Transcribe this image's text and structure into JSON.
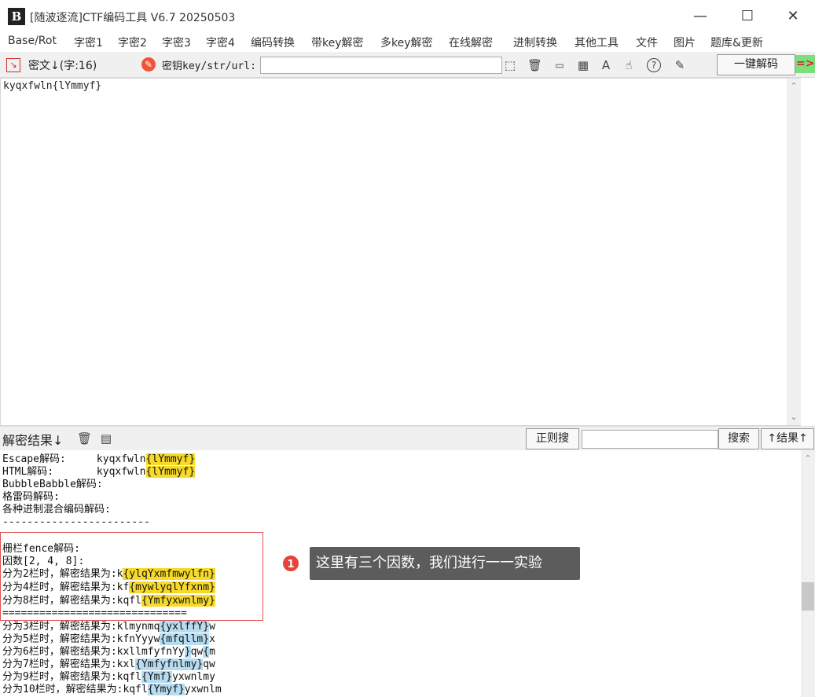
{
  "window": {
    "logo_text": "B",
    "title": "[随波逐流]CTF编码工具 V6.7  20250503",
    "minimize": "—",
    "maximize": "☐",
    "close": "✕"
  },
  "menu": [
    "Base/Rot",
    "字密1",
    "字密2",
    "字密3",
    "字密4",
    "编码转换",
    "带key解密",
    "多key解密",
    "在线解密",
    "进制转换",
    "其他工具",
    "文件",
    "图片",
    "题库&更新"
  ],
  "toolbar": {
    "cipher_label": "密文↓(字:16)",
    "key_label": "密钥key/str/url:",
    "key_value": "",
    "oneclick": "一键解码",
    "arrow": "=>"
  },
  "input": {
    "text": "kyqxfwln{lYmmyf}"
  },
  "result_bar": {
    "label": "解密结果↓",
    "regex_button": "正则搜",
    "regex_value": "",
    "search_button": "搜索",
    "result_button": "↑结果↑"
  },
  "output": {
    "escape_label": "Escape解码:     ",
    "escape_a": "kyqxfwln",
    "escape_b": "{lYmmyf}",
    "html_label": "HTML解码:       ",
    "html_a": "kyqxfwln",
    "html_b": "{lYmmyf}",
    "bubble": "BubbleBabble解码:",
    "grille": "格雷码解码:",
    "mixed": "各种进制混合编码解码:",
    "dash_line": "------------------------",
    "fence_title": "栅栏fence解码:",
    "factors": "因数[2, 4, 8]:",
    "r2_label": "分为2栏时，解密结果为:k",
    "r2_hl": "{ylqYxmfmwylfn}",
    "r4_label": "分为4栏时，解密结果为:kf",
    "r4_hl": "{mywlyqlYfxnm}",
    "r8_label": "分为8栏时，解密结果为:kqfl",
    "r8_hl": "{Ymfyxwnlmy}",
    "eq_line": "==============================",
    "r3_label": "分为3栏时，解密结果为:klmynmq",
    "r3_hl": "{yxlffY}",
    "r3_tail": "w",
    "r5_label": "分为5栏时，解密结果为:kfnYyyw",
    "r5_hl": "{mfqllm}",
    "r5_tail": "x",
    "r6_label": "分为6栏时，解密结果为:kxllmfyfnYy",
    "r6_hl": "}",
    "r6_mid": "qw",
    "r6_hl2": "{",
    "r6_tail": "m",
    "r7_label": "分为7栏时，解密结果为:kxl",
    "r7_hl": "{Ymfyfnlmy}",
    "r7_tail": "qw",
    "r9_label": "分为9栏时，解密结果为:kqfl",
    "r9_hl": "{Ymf}",
    "r9_tail": "yxwnlmy",
    "r10_label": "分为10栏时，解密结果为:kqfl",
    "r10_hl": "{Ymyf}",
    "r10_tail": "yxwnlm"
  },
  "callout": {
    "number": "1",
    "text": "这里有三个因数，我们进行一一实验"
  },
  "colors": {
    "highlight_yellow": "#f7d92a",
    "highlight_blue": "#b7dcf0",
    "annotation_red": "#e8423c"
  }
}
